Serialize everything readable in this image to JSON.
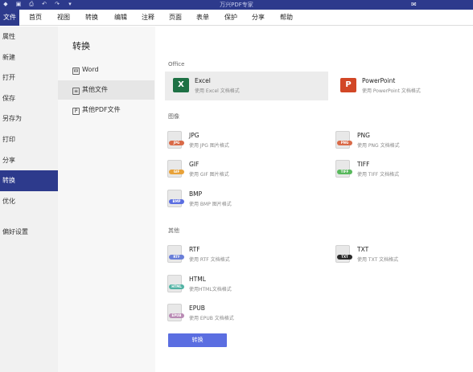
{
  "titlebar": {
    "title": "万兴PDF专家",
    "quick_access": [
      "app-logo-icon",
      "save-icon",
      "print-icon",
      "undo-icon",
      "redo-icon",
      "dropdown-icon"
    ]
  },
  "menubar": {
    "tabs": [
      "文件",
      "首页",
      "视图",
      "转换",
      "编辑",
      "注释",
      "页面",
      "表单",
      "保护",
      "分享",
      "帮助"
    ],
    "active": "文件"
  },
  "sidebar": {
    "items": [
      "属性",
      "新建",
      "打开",
      "保存",
      "另存为",
      "打印",
      "分享",
      "转换",
      "优化",
      "偏好设置"
    ],
    "active": "转换"
  },
  "midpanel": {
    "heading": "转换",
    "options": [
      "Word",
      "其他文件",
      "其他PDF文件"
    ],
    "active": "其他文件"
  },
  "content": {
    "sections": {
      "office": "Office",
      "image": "图像",
      "other": "其他"
    },
    "formats": {
      "excel": {
        "name": "Excel",
        "desc": "使用 Excel 文档格式"
      },
      "powerpoint": {
        "name": "PowerPoint",
        "desc": "使用 PowerPoint 文档格式"
      },
      "jpg": {
        "name": "JPG",
        "desc": "使用 JPG 图片格式",
        "badge": "JPG"
      },
      "png": {
        "name": "PNG",
        "desc": "使用 PNG 文档格式",
        "badge": "PNG"
      },
      "gif": {
        "name": "GIF",
        "desc": "使用 GIF 图片格式",
        "badge": "GIF"
      },
      "tiff": {
        "name": "TIFF",
        "desc": "使用 TIFF 文档格式",
        "badge": "TIFF"
      },
      "bmp": {
        "name": "BMP",
        "desc": "使用 BMP 图片格式",
        "badge": "BMP"
      },
      "rtf": {
        "name": "RTF",
        "desc": "使用 RTF 文档格式",
        "badge": "RTF"
      },
      "txt": {
        "name": "TXT",
        "desc": "使用 TXT 文档格式",
        "badge": "TXT"
      },
      "html": {
        "name": "HTML",
        "desc": "使用HTML文档格式",
        "badge": "HTML"
      },
      "epub": {
        "name": "EPUB",
        "desc": "使用 EPUB 文档格式",
        "badge": "EPUB"
      }
    },
    "convert_button": "转换"
  },
  "colors": {
    "brand": "#2d3a8c",
    "button": "#5b6ee1",
    "image_badge": "#d96a48",
    "gif_badge": "#e8a23a",
    "tiff_badge": "#58b85c",
    "bmp_badge": "#5b6ee1",
    "rtf_badge": "#6a7fd8",
    "txt_badge": "#2b2b2b",
    "html_badge": "#52b3a4",
    "epub_badge": "#b98ab4",
    "excel": "#1e7145",
    "powerpoint": "#d24726"
  }
}
